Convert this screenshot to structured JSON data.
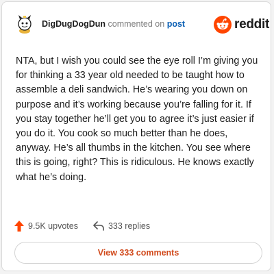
{
  "comment": {
    "username": "DigDugDogDun",
    "action": "commented on",
    "target": "post",
    "body": "NTA, but I wish you could see the eye roll I’m giving you for thinking a 33 year old needed to be taught how to assemble a deli sandwich. He’s wearing you down on purpose and it’s working because you’re falling for it. If you stay together he’ll get you to agree it’s just easier if you do it. You cook so much better than he does, anyway. He’s all thumbs in the kitchen. You see where this is going, right? This is ridiculous. He knows exactly what he’s doing."
  },
  "brand": {
    "wordmark": "reddit",
    "color": "#ff4500"
  },
  "stats": {
    "upvotes": "9.5K upvotes",
    "replies": "333 replies"
  },
  "cta": {
    "label": "View 333 comments"
  },
  "icons": {
    "avatar": "snoo-avatar-icon",
    "logo": "reddit-logo-icon",
    "upvote": "upvote-arrow-icon",
    "reply": "reply-arrow-icon"
  }
}
